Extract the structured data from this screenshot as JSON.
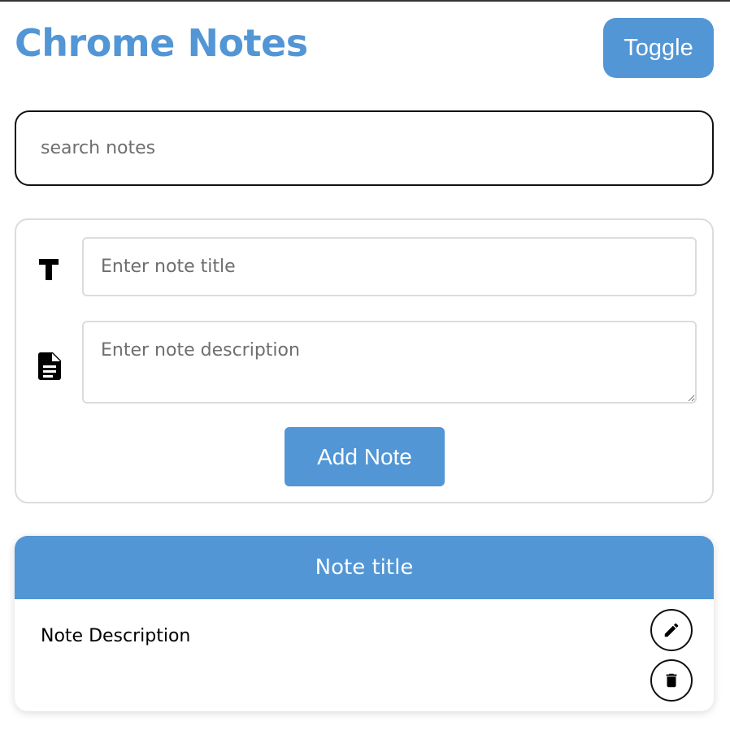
{
  "app": {
    "title": "Chrome Notes",
    "toggle_label": "Toggle"
  },
  "search": {
    "value": "",
    "placeholder": "search notes"
  },
  "form": {
    "title_value": "",
    "title_placeholder": "Enter note title",
    "description_value": "",
    "description_placeholder": "Enter note description",
    "add_button_label": "Add Note",
    "title_icon": "text-title-icon",
    "description_icon": "document-icon"
  },
  "notes": [
    {
      "title": "Note title",
      "description": "Note Description",
      "edit_icon": "pencil-icon",
      "delete_icon": "trash-icon"
    }
  ],
  "colors": {
    "accent": "#5296d5",
    "text": "#000000",
    "placeholder": "#6e6e6e",
    "border": "#dcdcdc"
  }
}
